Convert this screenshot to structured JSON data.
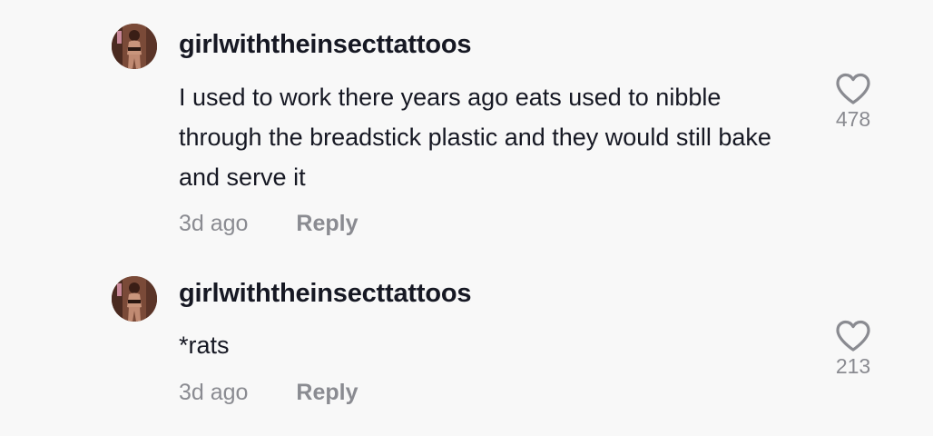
{
  "comments": [
    {
      "username": "girlwiththeinsecttattoos",
      "text": "I used to work there years ago eats used to nibble through the breadstick plastic and they would still bake and serve it",
      "time": "3d ago",
      "reply_label": "Reply",
      "like_count": "478",
      "avatar_icon": "user-avatar-photo",
      "like_icon": "heart-outline-icon"
    },
    {
      "username": "girlwiththeinsecttattoos",
      "text": "*rats",
      "time": "3d ago",
      "reply_label": "Reply",
      "like_count": "213",
      "avatar_icon": "user-avatar-photo",
      "like_icon": "heart-outline-icon"
    }
  ],
  "colors": {
    "background": "#f8f8f8",
    "text_primary": "#161823",
    "text_secondary": "#8a8b91"
  }
}
